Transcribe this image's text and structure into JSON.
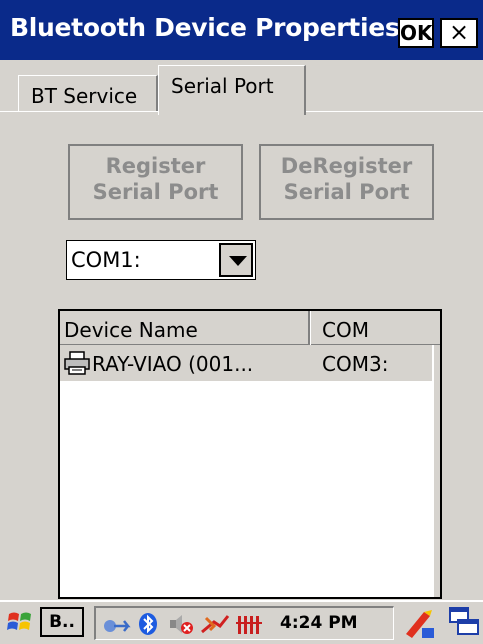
{
  "window": {
    "title": "Bluetooth Device Properties",
    "ok_label": "OK",
    "close_label": "×"
  },
  "tabs": [
    {
      "label": "BT Service",
      "active": false
    },
    {
      "label": "Serial Port",
      "active": true
    }
  ],
  "buttons": {
    "register": "Register\nSerial Port",
    "deregister": "DeRegister\nSerial Port"
  },
  "com_select": {
    "value": "COM1:"
  },
  "device_list": {
    "columns": [
      "Device Name",
      "COM"
    ],
    "rows": [
      {
        "name": "RAY-VIAO (001...",
        "com": "COM3:",
        "icon": "printer-icon"
      }
    ]
  },
  "taskbar": {
    "task_label": "B..",
    "clock": "4:24 PM",
    "icons": [
      "start-flag-icon",
      "network-icon",
      "bluetooth-icon",
      "volume-muted-icon",
      "power-icon",
      "signal-icon",
      "keyboard-icon",
      "desktop-icon"
    ]
  },
  "colors": {
    "titlebar": "#0a2a8a",
    "panel": "#d6d3ce",
    "disabled_text": "#8c8c8c"
  }
}
